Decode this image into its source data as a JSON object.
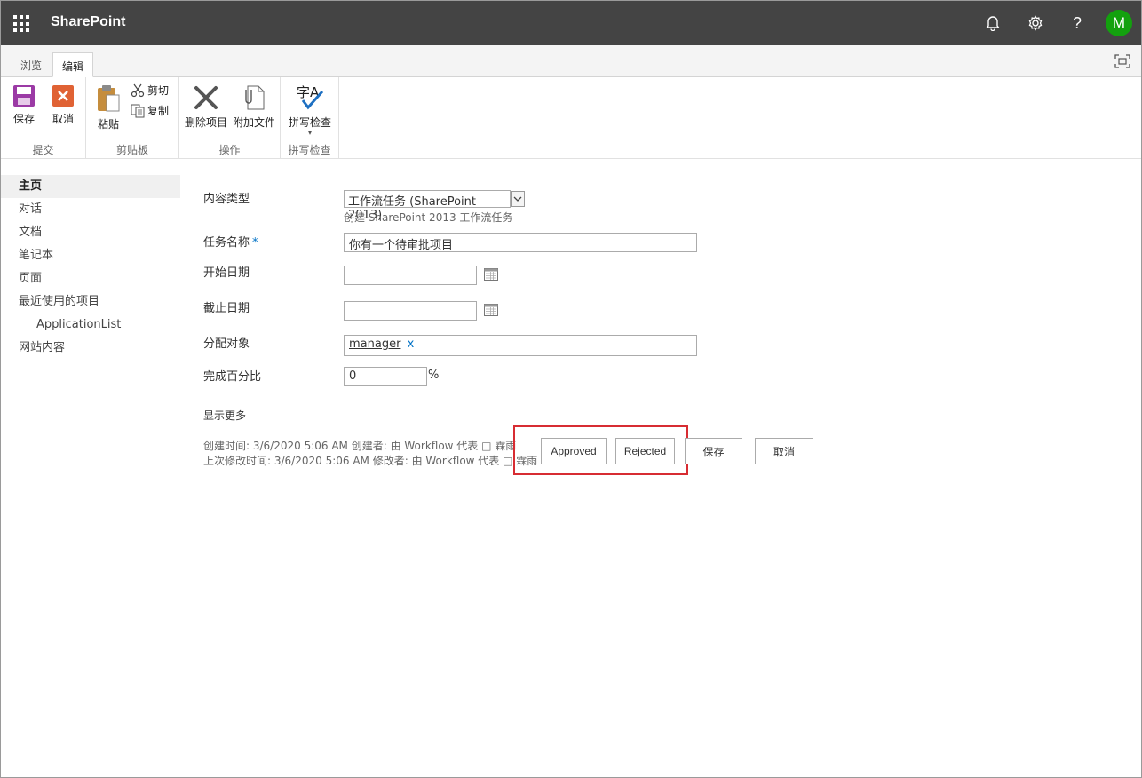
{
  "suite": {
    "brand": "SharePoint",
    "avatar_initial": "M",
    "avatar_color": "#13a10e",
    "icons": [
      "bell-icon",
      "gear-icon",
      "help-icon"
    ]
  },
  "ribbon": {
    "tabs": [
      "浏览",
      "编辑"
    ],
    "active_tab": "编辑",
    "groups": {
      "commit": {
        "label": "提交",
        "save": "保存",
        "cancel": "取消"
      },
      "clipboard": {
        "label": "剪贴板",
        "paste": "粘贴",
        "cut": "剪切",
        "copy": "复制"
      },
      "actions": {
        "label": "操作",
        "delete": "删除项目",
        "attach": "附加文件"
      },
      "spelling": {
        "label": "拼写检查",
        "spell": "拼写检查"
      }
    }
  },
  "nav": {
    "items": [
      "主页",
      "对话",
      "文档",
      "笔记本",
      "页面",
      "最近使用的项目",
      "ApplicationList",
      "网站内容"
    ]
  },
  "form": {
    "content_type": {
      "label": "内容类型",
      "value": "工作流任务 (SharePoint 2013)",
      "hint": "创建 SharePoint 2013 工作流任务"
    },
    "task_name": {
      "label": "任务名称",
      "required": "*",
      "value": "你有一个待审批项目"
    },
    "start_date": {
      "label": "开始日期",
      "value": ""
    },
    "due_date": {
      "label": "截止日期",
      "value": ""
    },
    "assigned_to": {
      "label": "分配对象",
      "value": "manager",
      "remove": "x"
    },
    "percent": {
      "label": "完成百分比",
      "value": "0",
      "unit": "%"
    },
    "show_more": "显示更多",
    "created": "创建时间: 3/6/2020 5:06 AM  创建者: 由 Workflow 代表 □ 霖雨",
    "modified": "上次修改时间: 3/6/2020 5:06 AM  修改者: 由 Workflow 代表 □ 霖雨",
    "buttons": {
      "approved": "Approved",
      "rejected": "Rejected",
      "save": "保存",
      "cancel": "取消"
    }
  },
  "colors": {
    "suitebar": "#444444",
    "accent": "#0072c6",
    "highlight": "#d72c32"
  }
}
